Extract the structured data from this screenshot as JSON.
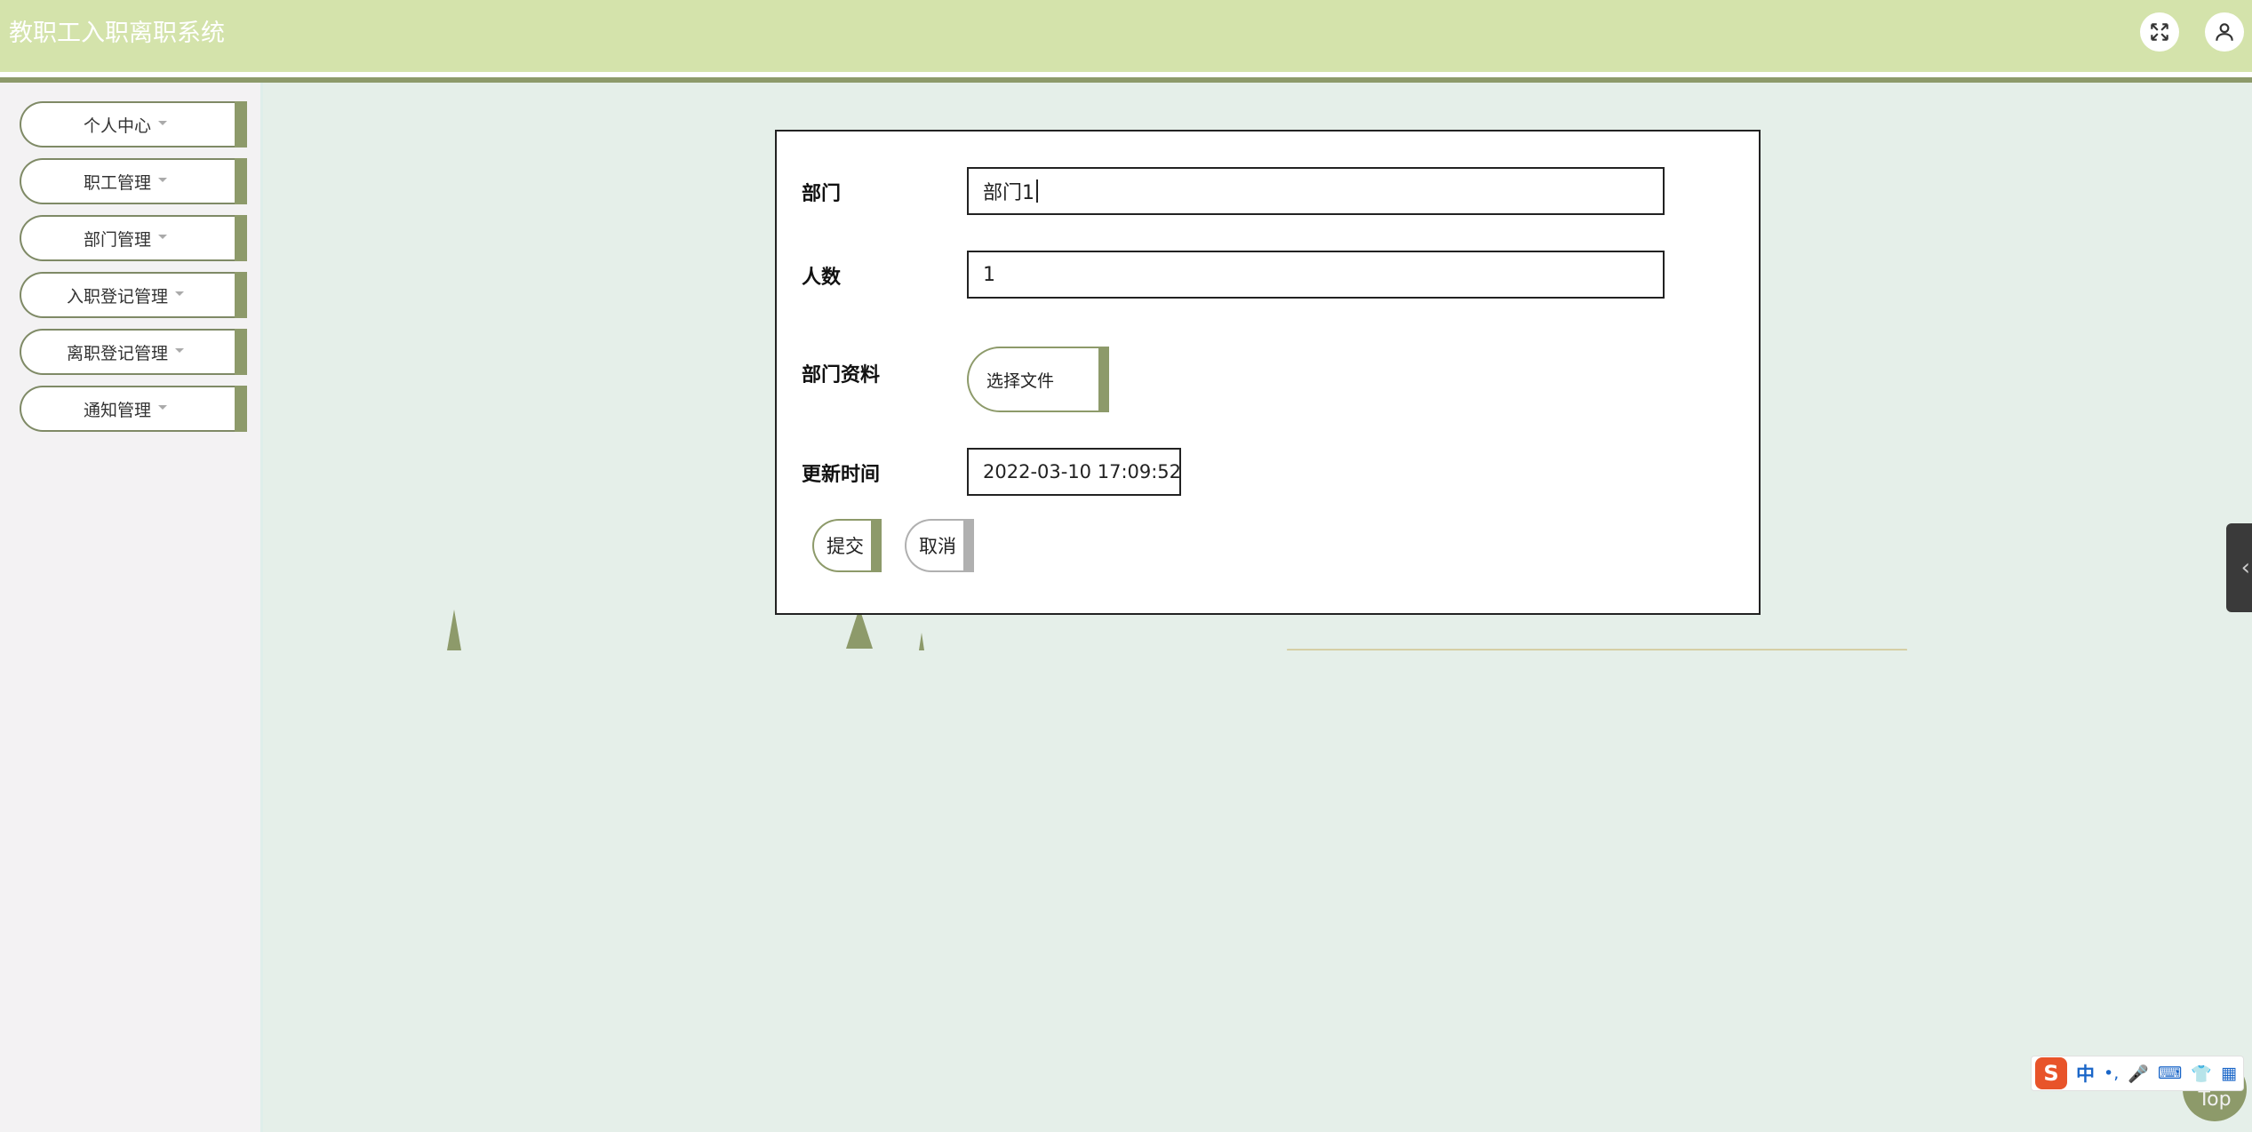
{
  "header": {
    "title": "教职工入职离职系统",
    "fullscreen_icon": "fullscreen-icon",
    "user_icon": "user-icon"
  },
  "sidebar": {
    "items": [
      {
        "label": "个人中心"
      },
      {
        "label": "职工管理"
      },
      {
        "label": "部门管理"
      },
      {
        "label": "入职登记管理"
      },
      {
        "label": "离职登记管理"
      },
      {
        "label": "通知管理"
      }
    ]
  },
  "form": {
    "department_label": "部门",
    "department_value": "部门1",
    "headcount_label": "人数",
    "headcount_value": "1",
    "materials_label": "部门资料",
    "materials_button": "选择文件",
    "updated_label": "更新时间",
    "updated_value": "2022-03-10 17:09:52",
    "submit_label": "提交",
    "cancel_label": "取消"
  },
  "floating": {
    "side_tab_icon": "chevron-left-icon",
    "top_label": "Top"
  },
  "ime": {
    "logo": "S",
    "mode": "中",
    "punct": "•,",
    "icons": [
      "microphone-icon",
      "keyboard-icon",
      "shirt-icon",
      "apps-icon"
    ]
  },
  "colors": {
    "header_bg": "#d4e3ab",
    "accent": "#8d9a6a",
    "page_bg": "#e5efe9",
    "sidebar_bg": "#f3f2f3",
    "hill": "#d2c896"
  }
}
